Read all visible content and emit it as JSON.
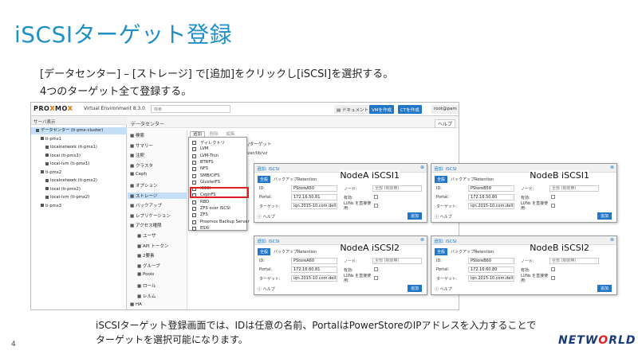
{
  "slide": {
    "title": "iSCSIターゲット登録",
    "line1": "[データセンター] – [ストレージ] で[追加]をクリックし[iSCSI]を選択する。",
    "line2": "4つのターゲット全て登録する。",
    "bottom1": "iSCSIターゲット登録画面では、IDは任意の名前、PortalはPowerStoreのIPアドレスを入力することで",
    "bottom2": "ターゲットを選択可能になります。",
    "page_number": "4",
    "brand_a": "NETW",
    "brand_b": "O",
    "brand_c": "RLD"
  },
  "pve": {
    "logo_a": "PRO",
    "logo_x": "X",
    "logo_b": "MO",
    "logo_c": "X",
    "version": "Virtual Environment 8.3.0",
    "search": "検索",
    "docs": "ドキュメント",
    "create_vm": "VMを作成",
    "create_ct": "CTを作成",
    "user": "root@pam",
    "view_label": "サーバ表示",
    "tree": [
      {
        "label": "データセンター (ti-pmx-cluster)",
        "indent": 1,
        "sel": true
      },
      {
        "label": "ti-pmx1",
        "indent": 2
      },
      {
        "label": "localnetwork (ti-pmx1)",
        "indent": 3
      },
      {
        "label": "local (ti-pmx1)",
        "indent": 3
      },
      {
        "label": "local-lvm (ti-pmx1)",
        "indent": 3
      },
      {
        "label": "ti-pmx2",
        "indent": 2
      },
      {
        "label": "localnetwork (ti-pmx2)",
        "indent": 3
      },
      {
        "label": "local (ti-pmx2)",
        "indent": 3
      },
      {
        "label": "local-lvm (ti-pmx2)",
        "indent": 3
      },
      {
        "label": "ti-pmx3",
        "indent": 2
      }
    ],
    "crumb": "データセンター",
    "help": "ヘルプ",
    "menu": [
      "検索",
      "サマリー",
      "注釈",
      "クラスタ",
      "Ceph",
      "オプション",
      "ストレージ",
      "バックアップ",
      "レプリケーション",
      "アクセス権限",
      "ユーザ",
      "API トークン",
      "2要素",
      "グループ",
      "Pools",
      "ロール",
      "レルム",
      "HA"
    ],
    "toolbar": {
      "add": "追加",
      "remove": "削除",
      "edit": "編集"
    },
    "col_header": "パス/ターゲット",
    "row_path": "var/lib/vz",
    "dropdown": [
      "ディレクトリ",
      "LVM",
      "LVM-Thin",
      "BTRFS",
      "NFS",
      "SMB/CIFS",
      "GlusterFS",
      "iSCSI",
      "CephFS",
      "RBD",
      "ZFS over iSCSI",
      "ZFS",
      "Proxmox Backup Server",
      "ESXi"
    ]
  },
  "dialogs": [
    {
      "tag": "NodeA iSCSI1",
      "head": "追加: iSCSI",
      "tab": "全般",
      "tab2": "バックアップRetention",
      "id": "PStoreA50",
      "portal": "172.16.50.81",
      "target": "iqn.2015-10.com.dell:dc",
      "node": "全部 (制限無)",
      "help": "ヘルプ",
      "add": "追加"
    },
    {
      "tag": "NodeB iSCSI1",
      "head": "追加: iSCSI",
      "tab": "全般",
      "tab2": "バックアップRetention",
      "id": "PStoreB50",
      "portal": "172.16.50.80",
      "target": "iqn.2015-10.com.dell:dc",
      "node": "全部 (制限無)",
      "help": "ヘルプ",
      "add": "追加"
    },
    {
      "tag": "NodeA iSCSI2",
      "head": "追加: iSCSI",
      "tab": "全般",
      "tab2": "バックアップRetention",
      "id": "PStoreA60",
      "portal": "172.16.60.81",
      "target": "iqn.2015-10.com.dell:dc",
      "node": "全部 (制限無)",
      "help": "ヘルプ",
      "add": "追加"
    },
    {
      "tag": "NodeB iSCSI2",
      "head": "追加: iSCSI",
      "tab": "全般",
      "tab2": "バックアップRetention",
      "id": "PStoreB60",
      "portal": "172.16.60.80",
      "target": "iqn.2015-10.com.dell:dc",
      "node": "全部 (制限無)",
      "help": "ヘルプ",
      "add": "追加"
    }
  ],
  "form_labels": {
    "id": "ID:",
    "portal": "Portal:",
    "target": "ターゲット:",
    "node": "ノード:",
    "enable": "有効:",
    "luns": "LUNs を直接使用:"
  },
  "colors": {
    "title": "#1f8fc7",
    "accent": "#2176c7",
    "highlight": "#e02020",
    "brand": "#1a3a7a"
  }
}
